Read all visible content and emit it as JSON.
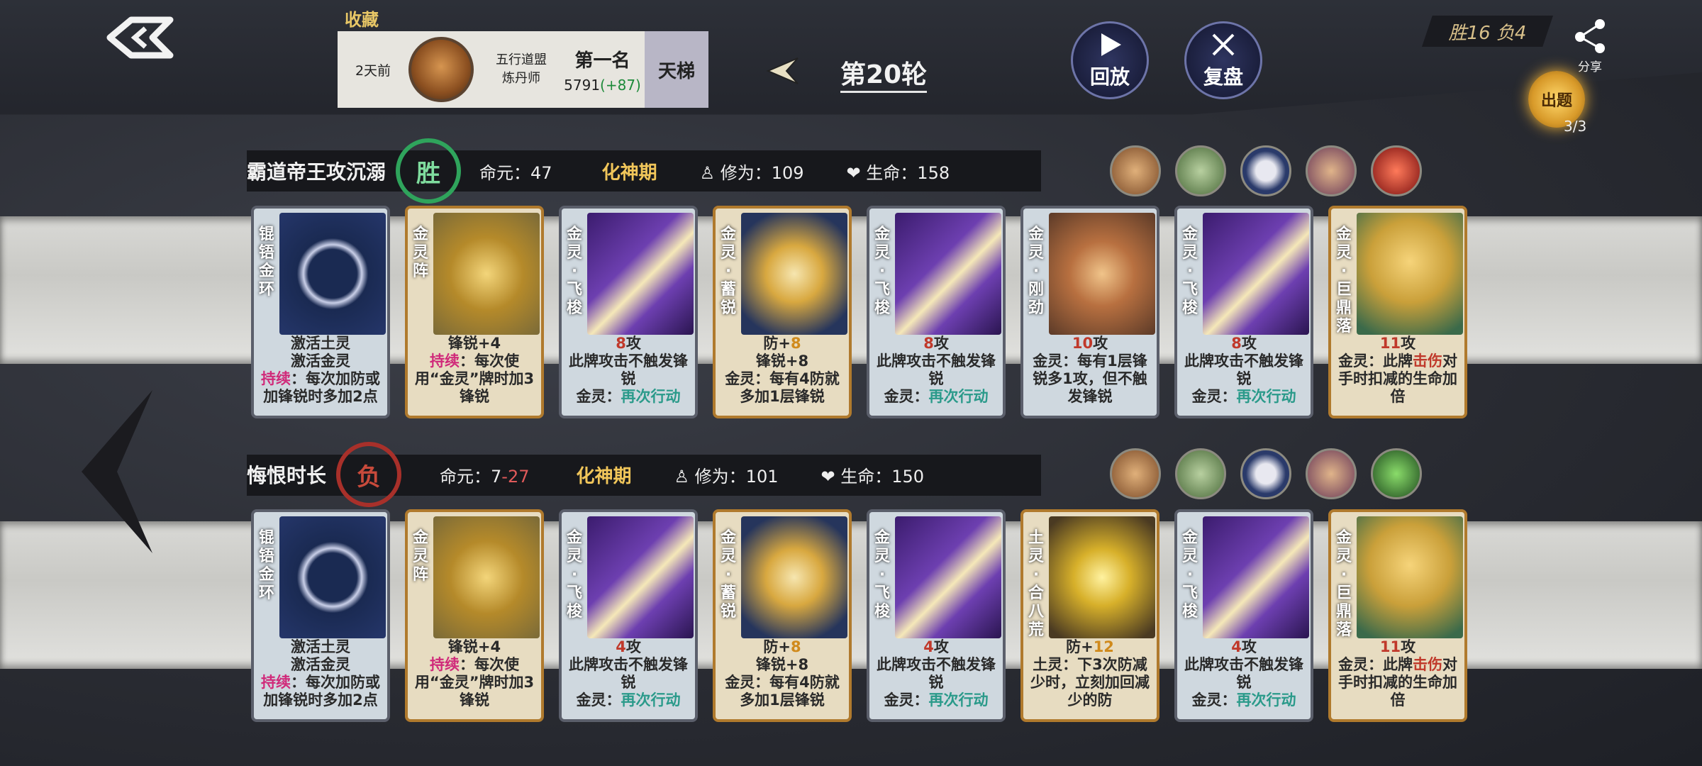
{
  "header": {
    "favorite_label": "收藏",
    "record": {
      "when": "2天前",
      "guild": "五行道盟",
      "title": "炼丹师",
      "rank": "第一名",
      "score": "5791",
      "gain": "(+87)"
    },
    "mode": "天梯",
    "round": "第20轮",
    "replay_label": "回放",
    "review_label": "复盘",
    "score_text": "胜16  负4",
    "share_label": "分享",
    "quiz_label": "出题",
    "quiz_count": "3/3"
  },
  "players": [
    {
      "name": "霸道帝王攻沉溺",
      "result": "胜",
      "life_label": "命元：",
      "life": "47",
      "life_delta": "",
      "realm": "化神期",
      "cult_label": "修为：",
      "cult": "109",
      "hp_label": "生命：",
      "hp": "158",
      "cards": [
        {
          "name": "锟铻金环",
          "art": "ring",
          "gold": false,
          "l1": "激活土灵",
          "l2": "激活金灵",
          "kw": "持续",
          "l3": "：每次加防或加锋锐时多加2点"
        },
        {
          "name": "金灵阵",
          "art": "tri",
          "gold": true,
          "l1": "锋锐+4",
          "kw": "持续",
          "l3": "：每次使用“金灵”牌时加3锋锐"
        },
        {
          "name": "金灵·飞梭",
          "art": "blade",
          "gold": false,
          "atk": "8",
          "atk_unit": "攻",
          "l2": "此牌攻击不触发锋锐",
          "k2": "金灵：",
          "kw2": "再次行动"
        },
        {
          "name": "金灵·蓄锐",
          "art": "rabbit",
          "gold": true,
          "def_label": "防+",
          "def": "8",
          "l2": "锋锐+8",
          "l3": "金灵：每有4防就多加1层锋锐"
        },
        {
          "name": "金灵·飞梭",
          "art": "blade",
          "gold": false,
          "atk": "8",
          "atk_unit": "攻",
          "l2": "此牌攻击不触发锋锐",
          "k2": "金灵：",
          "kw2": "再次行动"
        },
        {
          "name": "金灵·刚劲",
          "art": "tiger",
          "gold": false,
          "atk": "10",
          "atk_unit": "攻",
          "l2": "金灵：每有1层锋锐多1攻，但不触发锋锐"
        },
        {
          "name": "金灵·飞梭",
          "art": "blade",
          "gold": false,
          "atk": "8",
          "atk_unit": "攻",
          "l2": "此牌攻击不触发锋锐",
          "k2": "金灵：",
          "kw2": "再次行动"
        },
        {
          "name": "金灵·巨鼎落",
          "art": "fort",
          "gold": true,
          "atk": "11",
          "atk_unit": "攻",
          "l2a": "金灵：此牌",
          "kw3": "击伤",
          "l2b": "对手时扣减的生命加倍"
        }
      ]
    },
    {
      "name": "悔恨时长",
      "result": "负",
      "life_label": "命元：",
      "life": "7",
      "life_delta": "-27",
      "realm": "化神期",
      "cult_label": "修为：",
      "cult": "101",
      "hp_label": "生命：",
      "hp": "150",
      "cards": [
        {
          "name": "锟铻金环",
          "art": "ring",
          "gold": false,
          "l1": "激活土灵",
          "l2": "激活金灵",
          "kw": "持续",
          "l3": "：每次加防或加锋锐时多加2点"
        },
        {
          "name": "金灵阵",
          "art": "tri",
          "gold": true,
          "l1": "锋锐+4",
          "kw": "持续",
          "l3": "：每次使用“金灵”牌时加3锋锐"
        },
        {
          "name": "金灵·飞梭",
          "art": "blade",
          "gold": false,
          "atk": "4",
          "atk_unit": "攻",
          "l2": "此牌攻击不触发锋锐",
          "k2": "金灵：",
          "kw2": "再次行动"
        },
        {
          "name": "金灵·蓄锐",
          "art": "rabbit",
          "gold": true,
          "def_label": "防+",
          "def": "8",
          "l2": "锋锐+8",
          "l3": "金灵：每有4防就多加1层锋锐"
        },
        {
          "name": "金灵·飞梭",
          "art": "blade",
          "gold": false,
          "atk": "4",
          "atk_unit": "攻",
          "l2": "此牌攻击不触发锋锐",
          "k2": "金灵：",
          "kw2": "再次行动"
        },
        {
          "name": "土灵·合八荒",
          "art": "earth",
          "gold": true,
          "def_label": "防+",
          "def": "12",
          "l2": "土灵：下3次防减少时，立刻加回减少的防"
        },
        {
          "name": "金灵·飞梭",
          "art": "blade",
          "gold": false,
          "atk": "4",
          "atk_unit": "攻",
          "l2": "此牌攻击不触发锋锐",
          "k2": "金灵：",
          "kw2": "再次行动"
        },
        {
          "name": "金灵·巨鼎落",
          "art": "fort",
          "gold": true,
          "atk": "11",
          "atk_unit": "攻",
          "l2a": "金灵：此牌",
          "kw3": "击伤",
          "l2b": "对手时扣减的生命加倍"
        }
      ]
    }
  ],
  "icons_p1": [
    "tiger-portrait-icon",
    "frog-portrait-icon",
    "ring-icon",
    "tiger-warrior-icon",
    "fire-burst-icon"
  ],
  "icons_p2": [
    "tiger-portrait-icon",
    "frog-portrait-icon",
    "ring-icon",
    "tiger-warrior-icon",
    "earth-guard-icon"
  ],
  "colors": {
    "win": "#2fa45c",
    "loss": "#a8302a",
    "realm": "#f1c65a",
    "attack": "#c0392b",
    "accent_gold": "#b07a2d"
  }
}
